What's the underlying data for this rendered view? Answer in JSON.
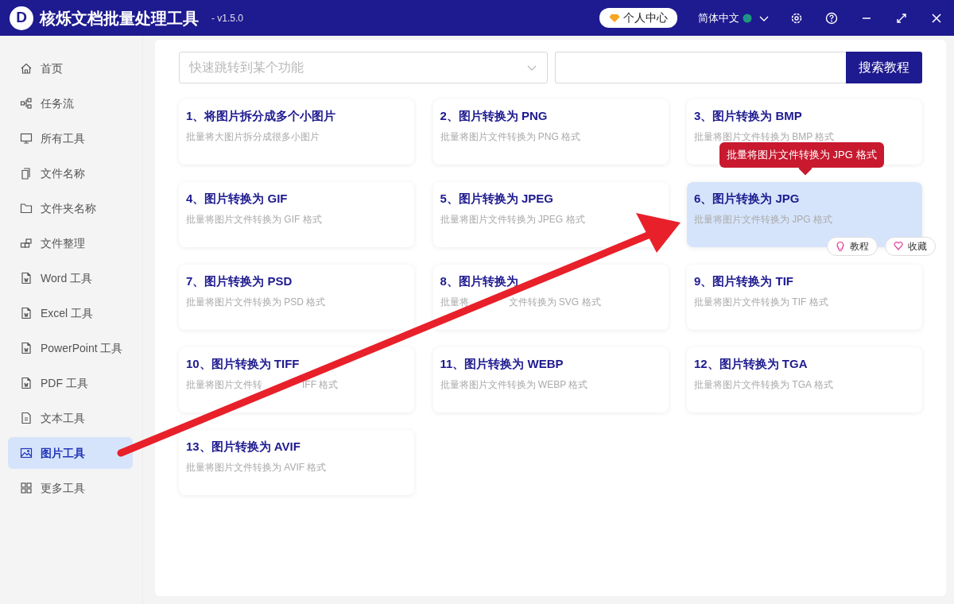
{
  "window": {
    "logo": "D",
    "title": "核烁文档批量处理工具",
    "version": "- v1.5.0"
  },
  "header": {
    "account_button": "个人中心",
    "language": "简体中文"
  },
  "sidebar": {
    "items": [
      {
        "label": "首页",
        "selected": false
      },
      {
        "label": "任务流",
        "selected": false
      },
      {
        "label": "所有工具",
        "selected": false
      },
      {
        "label": "文件名称",
        "selected": false
      },
      {
        "label": "文件夹名称",
        "selected": false
      },
      {
        "label": "文件整理",
        "selected": false
      },
      {
        "label": "Word 工具",
        "selected": false
      },
      {
        "label": "Excel 工具",
        "selected": false
      },
      {
        "label": "PowerPoint 工具",
        "selected": false
      },
      {
        "label": "PDF 工具",
        "selected": false
      },
      {
        "label": "文本工具",
        "selected": false
      },
      {
        "label": "图片工具",
        "selected": true
      },
      {
        "label": "更多工具",
        "selected": false
      }
    ]
  },
  "search": {
    "placeholder": "快速跳转到某个功能",
    "button": "搜索教程"
  },
  "tools": [
    {
      "title": "1、将图片拆分成多个小图片",
      "description": "批量将大图片拆分成很多小图片",
      "selected": false
    },
    {
      "title": "2、图片转换为 PNG",
      "description": "批量将图片文件转换为 PNG 格式",
      "selected": false
    },
    {
      "title": "3、图片转换为 BMP",
      "description": "批量将图片文件转换为 BMP 格式",
      "selected": false
    },
    {
      "title": "4、图片转换为 GIF",
      "description": "批量将图片文件转换为 GIF 格式",
      "selected": false
    },
    {
      "title": "5、图片转换为 JPEG",
      "description": "批量将图片文件转换为 JPEG 格式",
      "selected": false
    },
    {
      "title": "6、图片转换为 JPG",
      "description": "批量将图片文件转换为 JPG 格式",
      "selected": true,
      "actions": [
        {
          "label": "教程",
          "kind": "tutorial"
        },
        {
          "label": "收藏",
          "kind": "favorite"
        }
      ]
    },
    {
      "title": "7、图片转换为 PSD",
      "description": "批量将图片文件转换为 PSD 格式",
      "selected": false
    },
    {
      "title": "8、图片转换为",
      "description": [
        "批量将",
        "文件转换为 SVG 格式"
      ],
      "selected": false
    },
    {
      "title": "9、图片转换为 TIF",
      "description": "批量将图片文件转换为 TIF 格式",
      "selected": false
    },
    {
      "title": "10、图片转换为 TIFF",
      "description": [
        "批量将图片文件转",
        "IFF 格式"
      ],
      "selected": false
    },
    {
      "title": "11、图片转换为 WEBP",
      "description": "批量将图片文件转换为 WEBP 格式",
      "selected": false
    },
    {
      "title": "12、图片转换为 TGA",
      "description": "批量将图片文件转换为 TGA 格式",
      "selected": false
    },
    {
      "title": "13、图片转换为 AVIF",
      "description": "批量将图片文件转换为 AVIF 格式",
      "selected": false
    }
  ],
  "tooltip": {
    "text": "批量将图片文件转换为 JPG 格式"
  }
}
